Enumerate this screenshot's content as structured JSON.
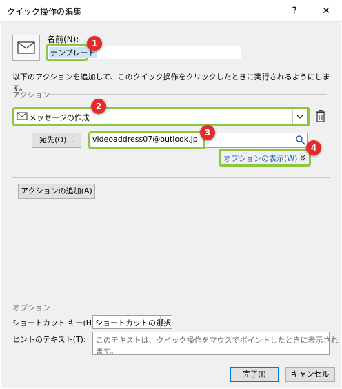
{
  "window": {
    "title": "クイック操作の編集",
    "help_label": "?",
    "close_label": "✕"
  },
  "name_field": {
    "label": "名前(N):",
    "value": "テンプレート"
  },
  "description": "以下のアクションを追加して、このクイック操作をクリックしたときに実行されるようにします。",
  "actions_section": {
    "heading": "アクション",
    "action_select_value": "メッセージの作成",
    "to_button_label": "宛先(O)...",
    "to_value": "videoaddress07@outlook.jp",
    "show_options_link": "オプションの表示(W)",
    "add_action_button": "アクションの追加(A)"
  },
  "options_section": {
    "heading": "オプション",
    "shortcut_label": "ショートカット キー(H):",
    "shortcut_value": "ショートカットの選択",
    "hint_label": "ヒントのテキスト(T):",
    "hint_placeholder": "このテキストは、クイック操作をマウスでポイントしたときに表示されます。"
  },
  "footer": {
    "finish_button": "完了(I)",
    "cancel_button": "キャンセル"
  },
  "badges": [
    "1",
    "2",
    "3",
    "4"
  ],
  "colors": {
    "highlight": "#8dc63f",
    "badge": "#e32b2b",
    "link": "#1e5fb3"
  },
  "icons": [
    "envelope-icon",
    "chevron-down-icon",
    "trash-icon",
    "address-book-icon",
    "double-chevron-down-icon"
  ]
}
